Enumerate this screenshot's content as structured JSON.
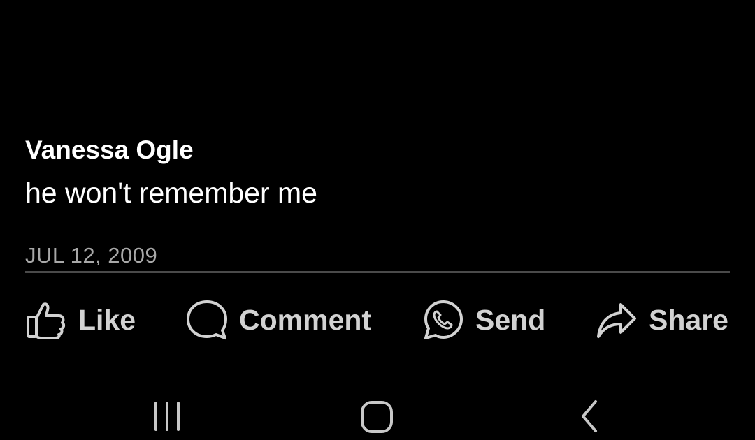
{
  "post": {
    "author": "Vanessa Ogle",
    "message": "he won't remember me",
    "timestamp": "JUL 12, 2009"
  },
  "actions": {
    "like": {
      "label": "Like",
      "icon": "thumbs-up-icon"
    },
    "comment": {
      "label": "Comment",
      "icon": "speech-bubble-icon"
    },
    "send": {
      "label": "Send",
      "icon": "whatsapp-icon"
    },
    "share": {
      "label": "Share",
      "icon": "share-arrow-icon"
    }
  },
  "navigation": {
    "recents_icon": "recent-apps-icon",
    "home_icon": "home-icon",
    "back_icon": "back-icon"
  },
  "colors": {
    "background": "#000000",
    "primary_text": "#ffffff",
    "secondary_text": "#a8a8a8",
    "action_text": "#d2d2d2",
    "divider": "#4a4a4a"
  }
}
